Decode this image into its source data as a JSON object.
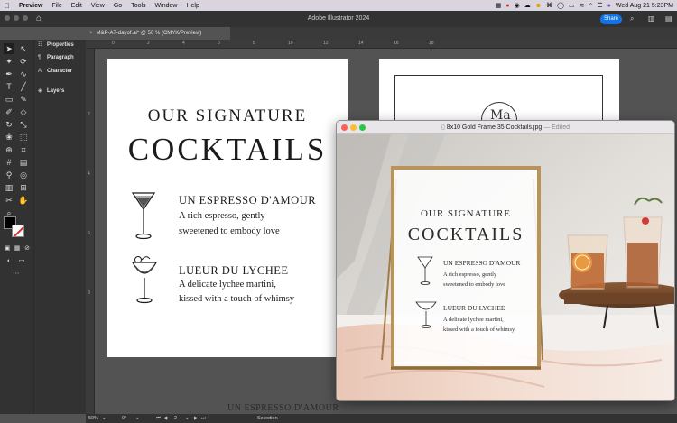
{
  "menubar": {
    "app": "Preview",
    "items": [
      "File",
      "Edit",
      "View",
      "Go",
      "Tools",
      "Window",
      "Help"
    ],
    "clock": "Wed Aug 21  5:23PM"
  },
  "illustrator": {
    "title": "Adobe Illustrator 2024",
    "share": "Share",
    "doc_tab": "M&P-A7-dayof.ai* @ 50 % (CMYK/Preview)",
    "close_glyph": "×"
  },
  "panel": {
    "tabs": [
      "Properties",
      "Paragraph",
      "Character",
      "Layers"
    ]
  },
  "rulers": {
    "top": [
      "0",
      "2",
      "4",
      "6",
      "8",
      "10",
      "12",
      "14",
      "16",
      "18"
    ],
    "left": [
      "2",
      "4",
      "6",
      "8"
    ]
  },
  "artboard": {
    "heading_line1": "OUR SIGNATURE",
    "heading_line2": "COCKTAILS",
    "items": [
      {
        "name": "UN ESPRESSO D'AMOUR",
        "line1": "A rich espresso, gently",
        "line2": "sweetened to embody love"
      },
      {
        "name": "LUEUR DU LYCHEE",
        "line1": "A delicate lychee martini,",
        "line2": "kissed with a touch of whimsy"
      }
    ],
    "monogram": "Ma"
  },
  "preview": {
    "title": "8x10 Gold Frame 35 Cocktails.jpg",
    "sep": "—",
    "edited": "Edited"
  },
  "status": {
    "zoom": "50%",
    "rotate": "0°",
    "artboard": "2",
    "tool": "Selection"
  },
  "ghost_text": "UN ESPRESSO D'AMOUR",
  "colors": {
    "accent": "#1473e6",
    "fill": "#000000",
    "stroke_slash": "#d9342b",
    "frame_gold": "#b8935a"
  }
}
